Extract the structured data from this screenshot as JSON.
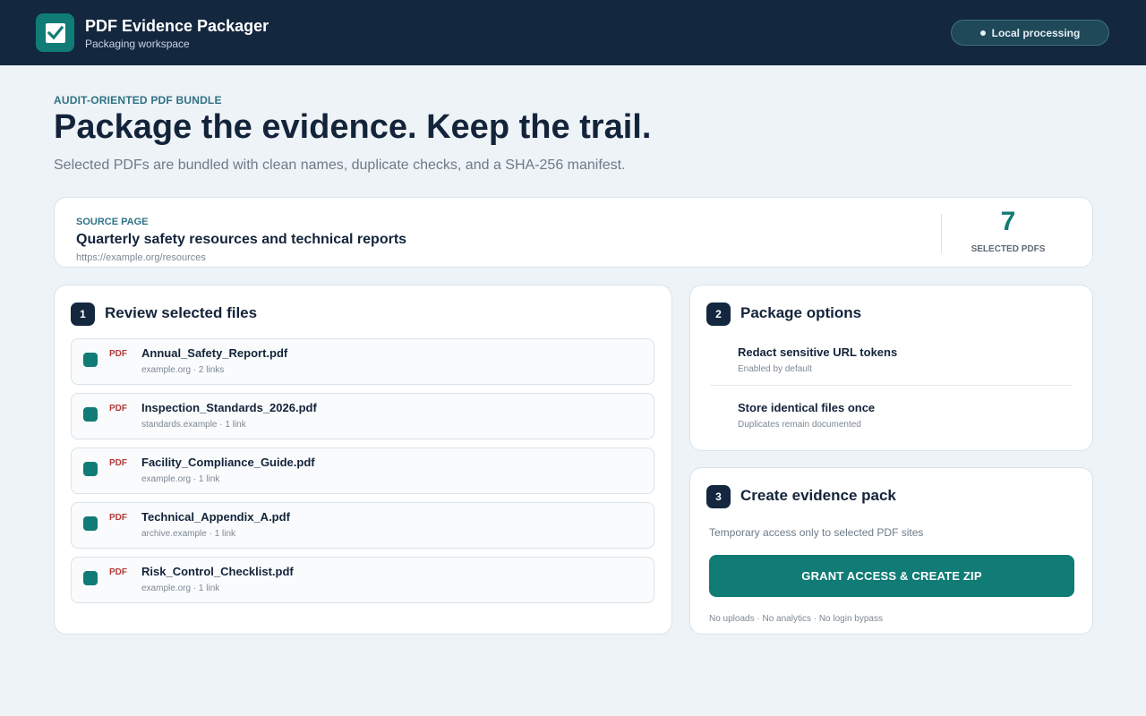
{
  "header": {
    "app_title": "PDF Evidence Packager",
    "app_subtitle": "Packaging workspace",
    "logo_icon": "check-document-icon",
    "status": "Local processing"
  },
  "hero": {
    "eyebrow": "AUDIT-ORIENTED PDF BUNDLE",
    "title": "Package the evidence. Keep the trail.",
    "subtitle": "Selected PDFs are bundled with clean names, duplicate checks, and a SHA-256 manifest."
  },
  "source": {
    "label": "SOURCE PAGE",
    "title": "Quarterly safety resources and technical reports",
    "url": "https://example.org/resources",
    "count": "7",
    "count_label": "SELECTED PDFS"
  },
  "review": {
    "step": "1",
    "title": "Review selected files",
    "files": [
      {
        "tag": "PDF",
        "name": "Annual_Safety_Report.pdf",
        "meta": "example.org · 2 links",
        "checked": true
      },
      {
        "tag": "PDF",
        "name": "Inspection_Standards_2026.pdf",
        "meta": "standards.example · 1 link",
        "checked": true
      },
      {
        "tag": "PDF",
        "name": "Facility_Compliance_Guide.pdf",
        "meta": "example.org · 1 link",
        "checked": true
      },
      {
        "tag": "PDF",
        "name": "Technical_Appendix_A.pdf",
        "meta": "archive.example · 1 link",
        "checked": true
      },
      {
        "tag": "PDF",
        "name": "Risk_Control_Checklist.pdf",
        "meta": "example.org · 1 link",
        "checked": true
      }
    ]
  },
  "options": {
    "step": "2",
    "title": "Package options",
    "items": [
      {
        "title": "Redact sensitive URL tokens",
        "subtitle": "Enabled by default"
      },
      {
        "title": "Store identical files once",
        "subtitle": "Duplicates remain documented"
      }
    ]
  },
  "create": {
    "step": "3",
    "title": "Create evidence pack",
    "note": "Temporary access only to selected PDF sites",
    "button": "GRANT ACCESS & CREATE ZIP",
    "footer": "No uploads · No analytics · No login bypass"
  },
  "colors": {
    "header_bg": "#13273f",
    "accent": "#117b76",
    "pdf_tag": "#b33a3a",
    "page_bg": "#eef3f7"
  }
}
